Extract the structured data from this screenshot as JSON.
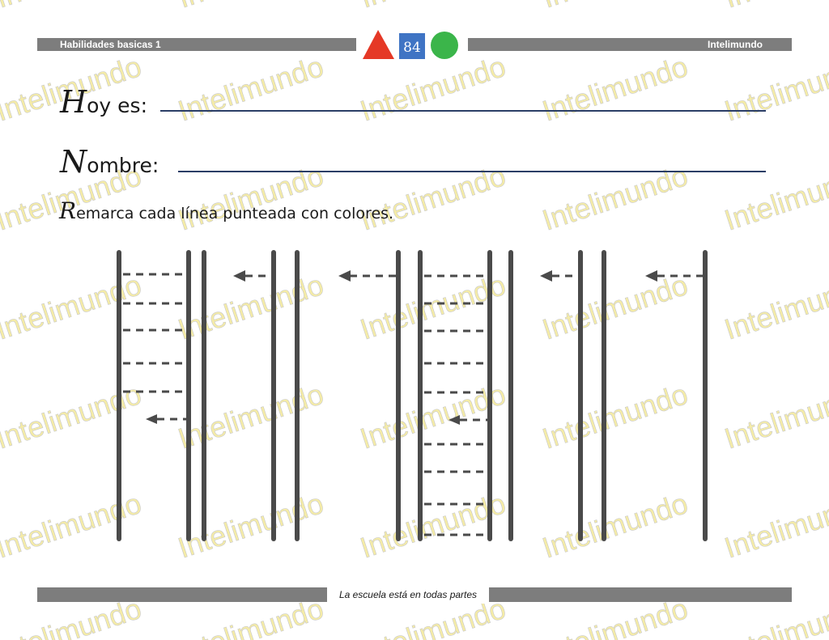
{
  "header": {
    "left_title": "Habilidades basicas 1",
    "page_number": "84",
    "right_title": "Intelimundo",
    "colors": {
      "triangle": "#e53826",
      "square": "#3f74c4",
      "circle": "#3bb54a",
      "bar": "#7d7d7d"
    }
  },
  "form": {
    "date_initial": "H",
    "date_rest": "oy es:",
    "name_initial": "N",
    "name_rest": "ombre:"
  },
  "instruction": {
    "initial": "R",
    "rest": "emarca cada línea punteada con colores."
  },
  "footer": {
    "text": "La escuela está en todas partes"
  },
  "watermark": {
    "text": "Intelimundo",
    "color": "#f1e58a"
  }
}
